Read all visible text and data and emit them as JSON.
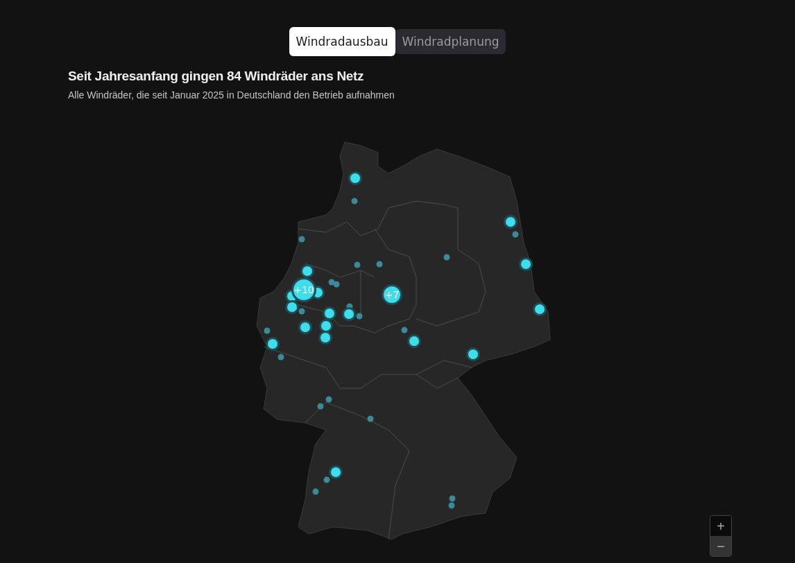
{
  "tabs": [
    {
      "label": "Windradausbau",
      "selected": true
    },
    {
      "label": "Windradplanung",
      "selected": false
    }
  ],
  "title": "Seit Jahresanfang gingen 84 Windräder ans Netz",
  "subtitle": "Alle Windräder, die seit Januar 2025 in Deutschland den Betrieb aufnahmen",
  "map": {
    "clusters": [
      {
        "label": "+10"
      },
      {
        "label": "+7"
      }
    ],
    "zoom_controls": [
      "+",
      "−"
    ]
  }
}
